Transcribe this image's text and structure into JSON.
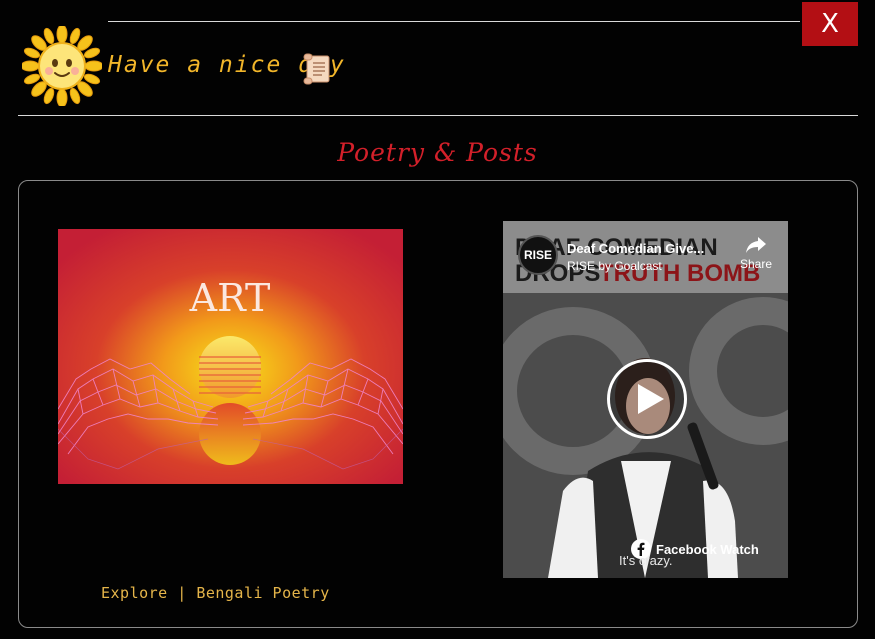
{
  "modal": {
    "close_label": "X",
    "greeting": "Have a nice day",
    "section_title": "Poetry & Posts"
  },
  "art_card": {
    "image_text": "ART",
    "explore_label": "Explore",
    "separator": "|",
    "category_label": "Bengali Poetry"
  },
  "video": {
    "channel_logo_text": "RISE",
    "title": "Deaf Comedian Give...",
    "channel": "RISE by Goalcast",
    "share_label": "Share",
    "thumbnail_headline_line1": "DEAF COMEDIAN",
    "thumbnail_headline_line2a": "DROPS",
    "thumbnail_headline_line2b": "TRUTH BOMB",
    "watch_label": "Facebook Watch",
    "caption": "It's crazy."
  },
  "colors": {
    "background": "#020202",
    "accent_gold": "#f2b62a",
    "title_red": "#d3202a",
    "close_red": "#b30f14",
    "link_gold": "#e5b54a"
  }
}
